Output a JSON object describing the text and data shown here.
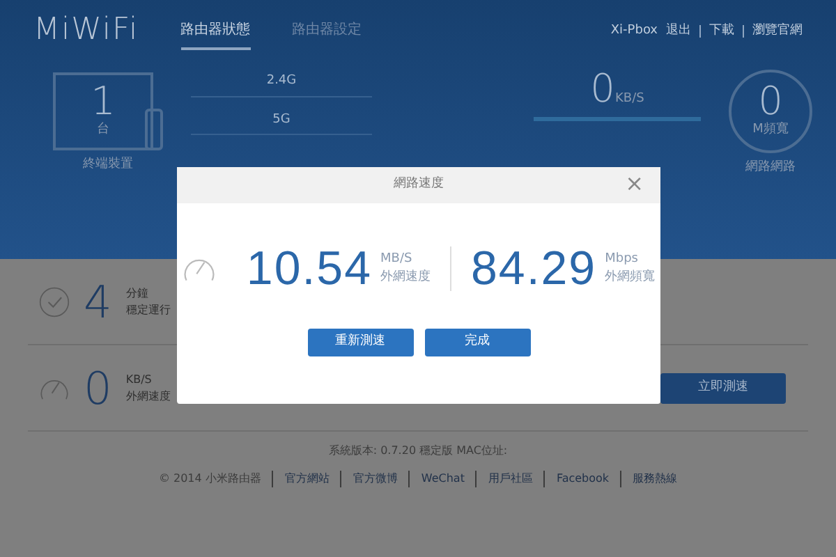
{
  "header": {
    "logo": "MiWiFi",
    "tabs": [
      {
        "label": "路由器狀態",
        "selected": true
      },
      {
        "label": "路由器設定",
        "selected": false
      }
    ],
    "links": [
      "Xi-Pbox",
      "退出",
      "下載",
      "瀏覽官網"
    ]
  },
  "status": {
    "devices": {
      "count": "1",
      "unit": "台",
      "label": "終端裝置"
    },
    "bands": [
      "2.4G",
      "5G"
    ],
    "traffic": {
      "value": "0",
      "unit": "KB/S"
    },
    "bandwidth": {
      "value": "0",
      "unit": "M頻寬",
      "label": "網路網路"
    }
  },
  "rows": [
    {
      "kind": "uptime",
      "value": "4",
      "unit": "分鐘",
      "label": "穩定運行"
    },
    {
      "kind": "speed",
      "value": "0",
      "unit": "KB/S",
      "label": "外網速度",
      "button": "立即測速"
    }
  ],
  "footer": {
    "version": "系統版本: 0.7.20 穩定版  MAC位址:",
    "links": [
      "© 2014 小米路由器",
      "官方網站",
      "官方微博",
      "WeChat",
      "用戶社區",
      "Facebook",
      "服務熱線"
    ]
  },
  "dialog": {
    "title": "網路速度",
    "close": "×",
    "metrics": [
      {
        "value": "10.54",
        "unit": "MB/S",
        "label": "外網速度"
      },
      {
        "value": "84.29",
        "unit": "Mbps",
        "label": "外網頻寬"
      }
    ],
    "buttons": [
      "重新測速",
      "完成"
    ]
  }
}
